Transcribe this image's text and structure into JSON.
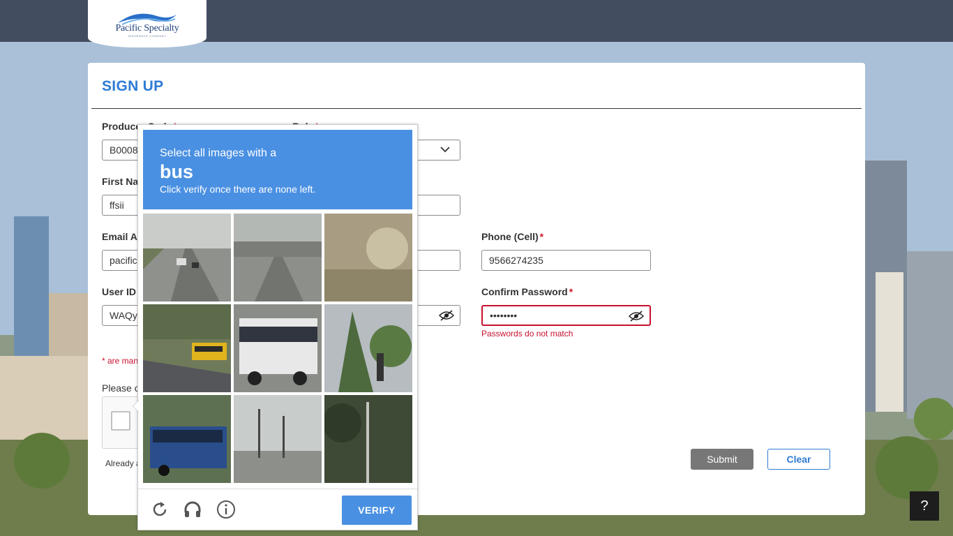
{
  "brand": {
    "name": "Pacific Specialty",
    "tagline": "INSURANCE COMPANY"
  },
  "form": {
    "title": "SIGN UP",
    "producer_code": {
      "label": "Producer Code",
      "value": "B0008"
    },
    "role": {
      "label": "Role"
    },
    "first_name": {
      "label": "First Name",
      "value": "ffsii"
    },
    "email": {
      "label": "Email Address",
      "value": "pacific"
    },
    "phone": {
      "label": "Phone (Cell)",
      "value": "9566274235"
    },
    "user_id": {
      "label": "User ID",
      "value": "WAQy"
    },
    "confirm_password": {
      "label": "Confirm Password",
      "value": "••••••••",
      "error": "Passwords do not match"
    },
    "required_marker": "*",
    "mandatory_note": "* are mandatory",
    "please_text": "Please c",
    "already_text": "Already a",
    "submit_label": "Submit",
    "clear_label": "Clear"
  },
  "challenge": {
    "line1": "Select all images with a",
    "target": "bus",
    "line3": "Click verify once there are none left.",
    "verify_label": "VERIFY",
    "tiles": [
      "highway-cars",
      "overpass-road",
      "blurry-closeup",
      "school-bus",
      "white-city-bus",
      "trees-sign",
      "blue-bus",
      "power-poles-street",
      "dark-trees-pole"
    ]
  },
  "help": {
    "label": "?"
  }
}
